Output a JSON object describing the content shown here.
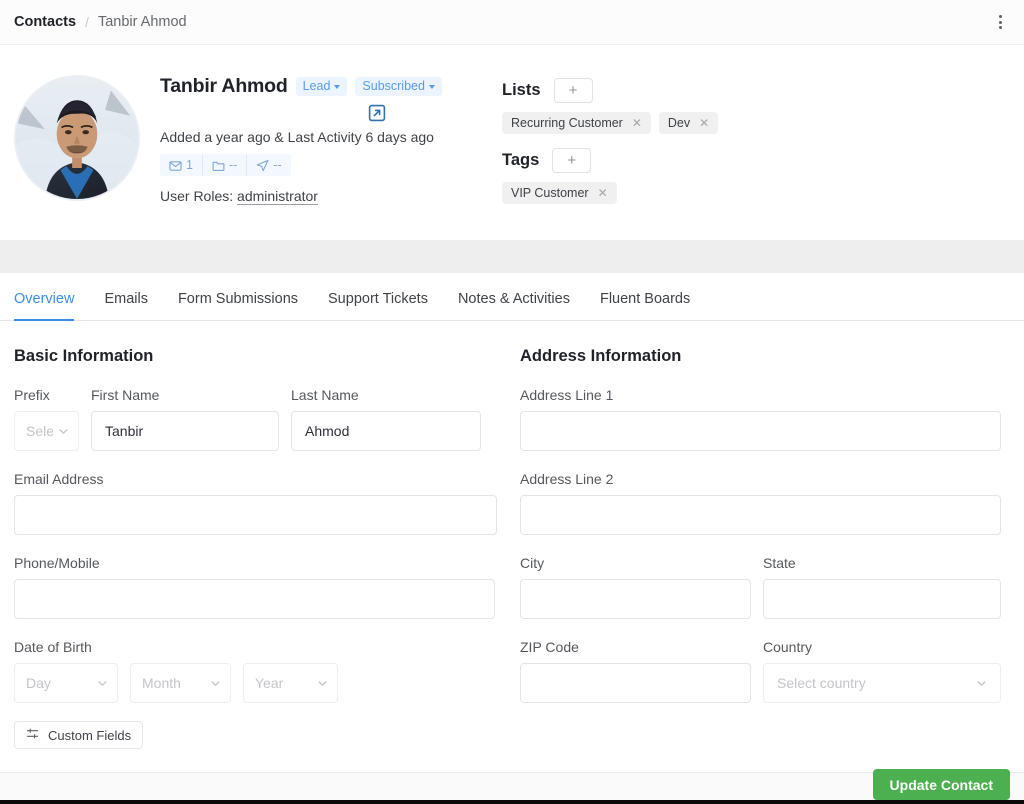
{
  "breadcrumb": {
    "root": "Contacts",
    "separator": "/",
    "leaf": "Tanbir Ahmod"
  },
  "header": {
    "menu_icon": "kebab-menu-icon"
  },
  "profile": {
    "avatar_alt": "contact-avatar",
    "name": "Tanbir Ahmod",
    "status_badge": "Lead",
    "subscription_badge": "Subscribed",
    "external_link_icon": "external-link-icon",
    "activity_line": "Added a year ago & Last Activity 6 days ago",
    "stats": [
      {
        "icon": "envelope-icon",
        "value": "1"
      },
      {
        "icon": "folder-icon",
        "value": "--"
      },
      {
        "icon": "send-icon",
        "value": "--"
      }
    ],
    "roles_label": "User Roles:",
    "roles_value": "administrator"
  },
  "lists": {
    "title": "Lists",
    "add_label": "+",
    "chips": [
      "Recurring Customer",
      "Dev"
    ]
  },
  "tags": {
    "title": "Tags",
    "add_label": "+",
    "chips": [
      "VIP Customer"
    ]
  },
  "tabs": [
    {
      "label": "Overview",
      "active": true
    },
    {
      "label": "Emails",
      "active": false
    },
    {
      "label": "Form Submissions",
      "active": false
    },
    {
      "label": "Support Tickets",
      "active": false
    },
    {
      "label": "Notes & Activities",
      "active": false
    },
    {
      "label": "Fluent Boards",
      "active": false
    }
  ],
  "basic_information": {
    "title": "Basic Information",
    "prefix": {
      "label": "Prefix",
      "value": "",
      "placeholder": "Select"
    },
    "first_name": {
      "label": "First Name",
      "value": "Tanbir",
      "placeholder": ""
    },
    "last_name": {
      "label": "Last Name",
      "value": "Ahmod",
      "placeholder": ""
    },
    "email": {
      "label": "Email Address",
      "value": "",
      "placeholder": ""
    },
    "phone": {
      "label": "Phone/Mobile",
      "value": "",
      "placeholder": ""
    },
    "dob": {
      "label": "Date of Birth",
      "day": "Day",
      "month": "Month",
      "year": "Year"
    },
    "custom_fields_button": "Custom Fields"
  },
  "address_information": {
    "title": "Address Information",
    "address_line_1": {
      "label": "Address Line 1",
      "value": "",
      "placeholder": ""
    },
    "address_line_2": {
      "label": "Address Line 2",
      "value": "",
      "placeholder": ""
    },
    "city": {
      "label": "City",
      "value": "",
      "placeholder": ""
    },
    "state": {
      "label": "State",
      "value": "",
      "placeholder": ""
    },
    "zip": {
      "label": "ZIP Code",
      "value": "",
      "placeholder": ""
    },
    "country": {
      "label": "Country",
      "value": "",
      "placeholder": "Select country"
    }
  },
  "footer": {
    "update_button": "Update Contact"
  },
  "colors": {
    "accent_blue": "#3a8ee6",
    "badge_bg": "#ecf5ff",
    "badge_text": "#5a9bef",
    "chip_bg": "#f0f0f1",
    "band_gray": "#eeeeee",
    "success_green": "#4caf50"
  }
}
